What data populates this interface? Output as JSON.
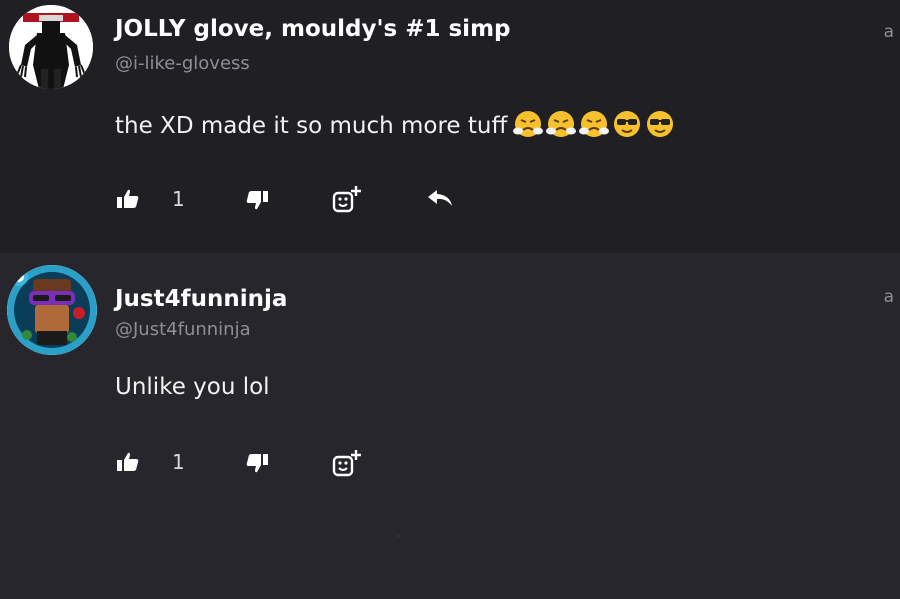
{
  "comments": [
    {
      "display_name": "JOLLY glove, mouldy's #1 simp",
      "handle": "@i-like-glovess",
      "text": "the XD made it so much more tuff",
      "emojis": [
        "steam-from-nose",
        "steam-from-nose",
        "steam-from-nose",
        "sunglasses",
        "sunglasses"
      ],
      "likes": "1",
      "truncated_label": "a",
      "has_reply_action": true
    },
    {
      "display_name": "Just4funninja",
      "handle": "@Just4funninja",
      "text": "Unlike you lol",
      "likes": "1",
      "truncated_label": "a",
      "has_reply_action": false
    }
  ],
  "icons": {
    "like": "thumbs-up-icon",
    "dislike": "thumbs-down-icon",
    "react": "add-reaction-icon",
    "reply": "reply-icon"
  },
  "colors": {
    "background_top": "#1f1f24",
    "background_bottom": "#26262c",
    "text": "#f2f2f2",
    "muted": "#8e8e96",
    "emoji_yellow": "#f6c12d"
  }
}
